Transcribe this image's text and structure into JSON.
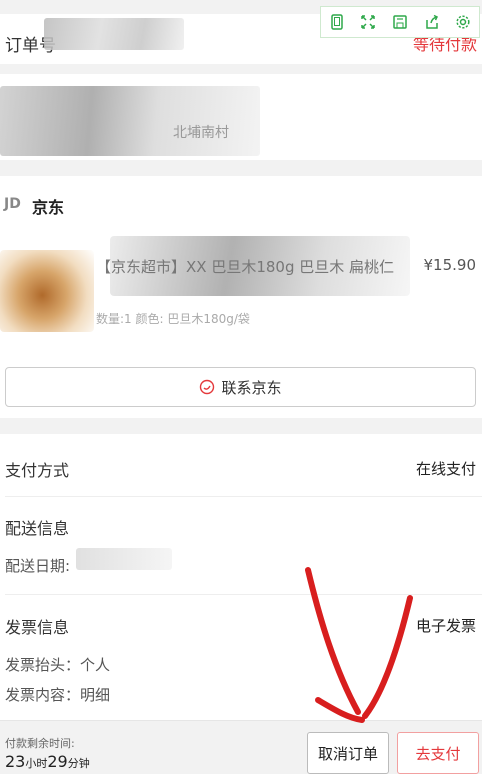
{
  "toolbar": {
    "icons": [
      "phone-icon",
      "expand-icon",
      "save-icon",
      "share-icon",
      "settings-icon"
    ],
    "accent": "#2ea84a"
  },
  "order": {
    "label": "订单号",
    "status": "等待付款",
    "status_color": "#e4393c"
  },
  "address": {
    "visible_text": "北埔南村"
  },
  "shop": {
    "logo": "JD",
    "name": "京东",
    "product_title": "【京东超市】XX 巴旦木180g 巴旦木 扁桃仁",
    "product_spec": "数量:1 颜色: 巴旦木180g/袋",
    "product_price": "¥15.90",
    "contact_label": "联系京东"
  },
  "payment": {
    "label": "支付方式",
    "value": "在线支付"
  },
  "delivery": {
    "label": "配送信息",
    "date_label": "配送日期:"
  },
  "invoice": {
    "label": "发票信息",
    "value": "电子发票",
    "title_line": "发票抬头：个人",
    "content_line": "发票内容：明细"
  },
  "bottom": {
    "remaining_label": "付款剩余时间:",
    "hours": "23",
    "hours_unit": "小时",
    "minutes": "29",
    "minutes_unit": "分钟",
    "cancel_label": "取消订单",
    "pay_label": "去支付"
  }
}
